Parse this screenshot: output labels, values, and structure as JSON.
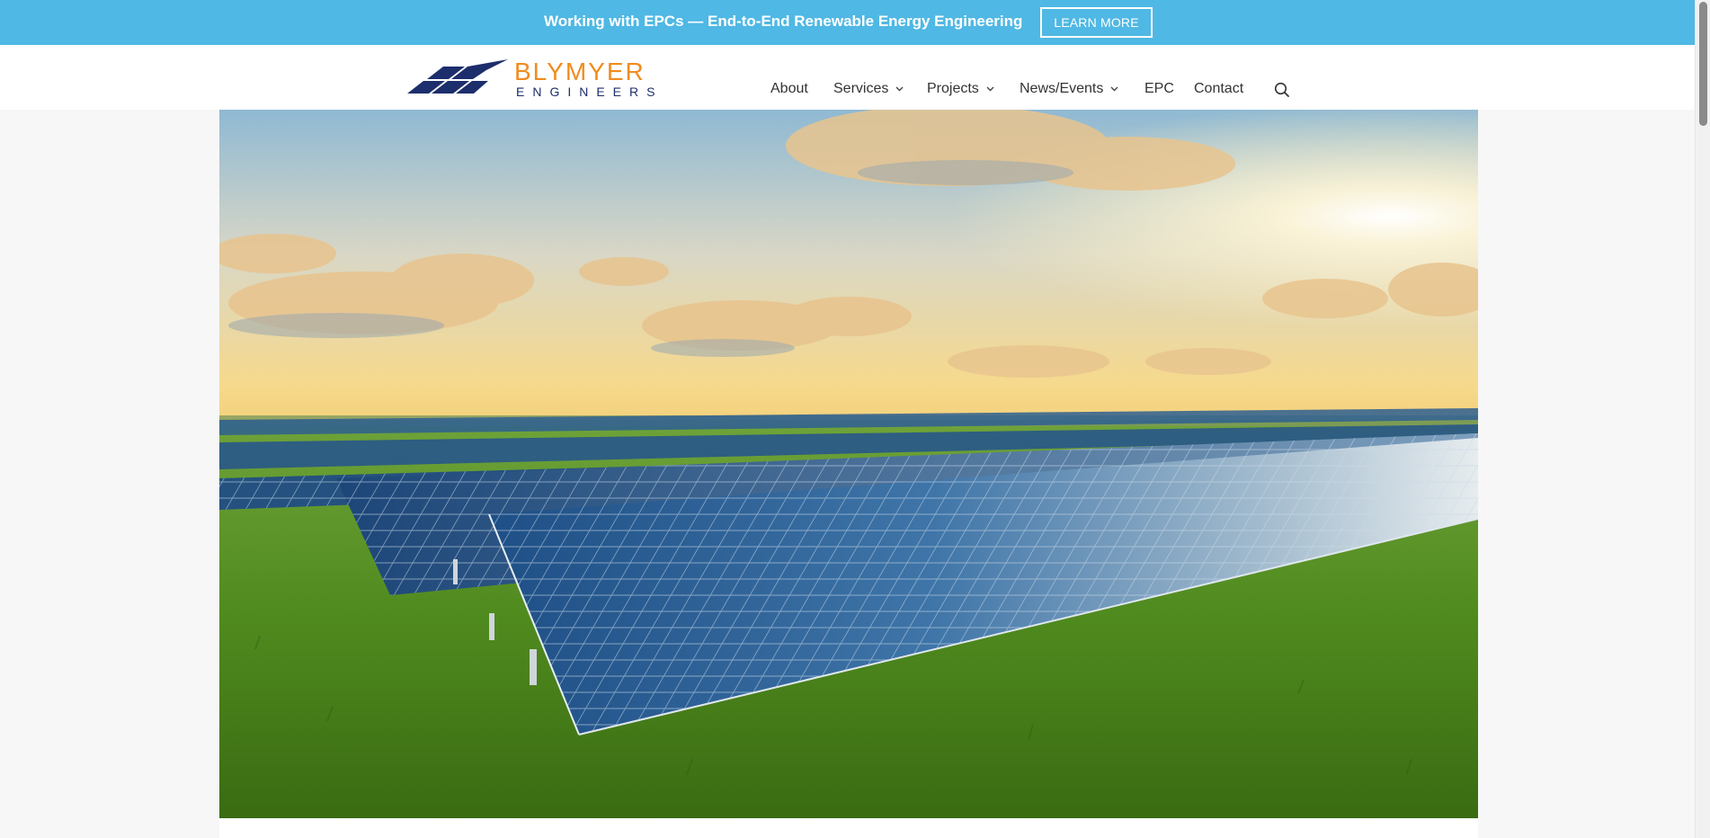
{
  "banner": {
    "text": "Working with EPCs — End-to-End Renewable Energy Engineering",
    "button_label": "LEARN MORE",
    "background_color": "#4fb8e4"
  },
  "logo": {
    "name": "BLYMYER",
    "sub": "ENGINEERS",
    "brand_orange": "#f08c1e",
    "brand_navy": "#1d2e6d"
  },
  "nav": {
    "items": [
      {
        "label": "About",
        "has_dropdown": false
      },
      {
        "label": "Services",
        "has_dropdown": true
      },
      {
        "label": "Projects",
        "has_dropdown": true
      },
      {
        "label": "News/Events",
        "has_dropdown": true
      },
      {
        "label": "EPC",
        "has_dropdown": false
      },
      {
        "label": "Contact",
        "has_dropdown": false
      }
    ],
    "search_icon": "search-icon"
  },
  "hero": {
    "image": "solar-panel-field-at-sunset"
  }
}
